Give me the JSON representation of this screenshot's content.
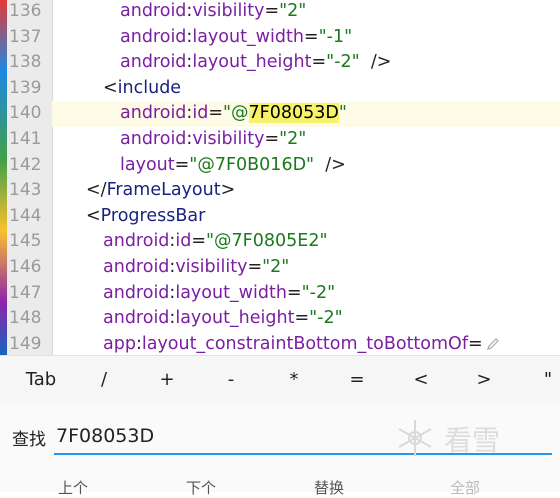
{
  "editor": {
    "lines": [
      {
        "num": "136",
        "indent": 4,
        "parts": [
          {
            "t": "ns",
            "v": "android"
          },
          {
            "t": "punc",
            "v": ":"
          },
          {
            "t": "ns",
            "v": "visibility"
          },
          {
            "t": "punc",
            "v": "="
          },
          {
            "t": "str",
            "v": "\"2\""
          }
        ]
      },
      {
        "num": "137",
        "indent": 4,
        "parts": [
          {
            "t": "ns",
            "v": "android"
          },
          {
            "t": "punc",
            "v": ":"
          },
          {
            "t": "ns",
            "v": "layout_width"
          },
          {
            "t": "punc",
            "v": "="
          },
          {
            "t": "str",
            "v": "\"-1\""
          }
        ]
      },
      {
        "num": "138",
        "indent": 4,
        "parts": [
          {
            "t": "ns",
            "v": "android"
          },
          {
            "t": "punc",
            "v": ":"
          },
          {
            "t": "ns",
            "v": "layout_height"
          },
          {
            "t": "punc",
            "v": "="
          },
          {
            "t": "str",
            "v": "\"-2\""
          },
          {
            "t": "punc",
            "v": "  />"
          }
        ]
      },
      {
        "num": "139",
        "indent": 3,
        "parts": [
          {
            "t": "punc",
            "v": "<"
          },
          {
            "t": "tag",
            "v": "include"
          }
        ]
      },
      {
        "num": "140",
        "indent": 4,
        "highlight": true,
        "parts": [
          {
            "t": "ns",
            "v": "android"
          },
          {
            "t": "punc",
            "v": ":"
          },
          {
            "t": "ns",
            "v": "id"
          },
          {
            "t": "punc",
            "v": "="
          },
          {
            "t": "str",
            "v": "\"@"
          },
          {
            "t": "sel",
            "v": "7F08053D"
          },
          {
            "t": "str",
            "v": "\""
          }
        ]
      },
      {
        "num": "141",
        "indent": 4,
        "parts": [
          {
            "t": "ns",
            "v": "android"
          },
          {
            "t": "punc",
            "v": ":"
          },
          {
            "t": "ns",
            "v": "visibility"
          },
          {
            "t": "punc",
            "v": "="
          },
          {
            "t": "str",
            "v": "\"2\""
          }
        ]
      },
      {
        "num": "142",
        "indent": 4,
        "parts": [
          {
            "t": "ns",
            "v": "layout"
          },
          {
            "t": "punc",
            "v": "="
          },
          {
            "t": "str",
            "v": "\"@7F0B016D\""
          },
          {
            "t": "punc",
            "v": "  />"
          }
        ]
      },
      {
        "num": "143",
        "indent": 2,
        "parts": [
          {
            "t": "punc",
            "v": "</"
          },
          {
            "t": "tag",
            "v": "FrameLayout"
          },
          {
            "t": "punc",
            "v": ">"
          }
        ]
      },
      {
        "num": "144",
        "indent": 2,
        "parts": [
          {
            "t": "punc",
            "v": "<"
          },
          {
            "t": "tag",
            "v": "ProgressBar"
          }
        ]
      },
      {
        "num": "145",
        "indent": 3,
        "parts": [
          {
            "t": "ns",
            "v": "android"
          },
          {
            "t": "punc",
            "v": ":"
          },
          {
            "t": "ns",
            "v": "id"
          },
          {
            "t": "punc",
            "v": "="
          },
          {
            "t": "str",
            "v": "\"@7F0805E2\""
          }
        ]
      },
      {
        "num": "146",
        "indent": 3,
        "parts": [
          {
            "t": "ns",
            "v": "android"
          },
          {
            "t": "punc",
            "v": ":"
          },
          {
            "t": "ns",
            "v": "visibility"
          },
          {
            "t": "punc",
            "v": "="
          },
          {
            "t": "str",
            "v": "\"2\""
          }
        ]
      },
      {
        "num": "147",
        "indent": 3,
        "parts": [
          {
            "t": "ns",
            "v": "android"
          },
          {
            "t": "punc",
            "v": ":"
          },
          {
            "t": "ns",
            "v": "layout_width"
          },
          {
            "t": "punc",
            "v": "="
          },
          {
            "t": "str",
            "v": "\"-2\""
          }
        ]
      },
      {
        "num": "148",
        "indent": 3,
        "parts": [
          {
            "t": "ns",
            "v": "android"
          },
          {
            "t": "punc",
            "v": ":"
          },
          {
            "t": "ns",
            "v": "layout_height"
          },
          {
            "t": "punc",
            "v": "="
          },
          {
            "t": "str",
            "v": "\"-2\""
          }
        ]
      },
      {
        "num": "149",
        "indent": 3,
        "parts": [
          {
            "t": "ns",
            "v": "app"
          },
          {
            "t": "punc",
            "v": ":"
          },
          {
            "t": "ns",
            "v": "layout_constraintBottom_toBottomOf"
          },
          {
            "t": "punc",
            "v": "="
          }
        ]
      }
    ]
  },
  "symbol_bar": {
    "keys": [
      "Tab",
      "/",
      "+",
      "-",
      "*",
      "=",
      "<",
      ">",
      "\""
    ]
  },
  "find": {
    "label": "查找",
    "value": "7F08053D"
  },
  "watermark": {
    "text": "看雪"
  },
  "actions": {
    "prev": "上个",
    "next": "下个",
    "replace": "替换",
    "all": "全部"
  }
}
